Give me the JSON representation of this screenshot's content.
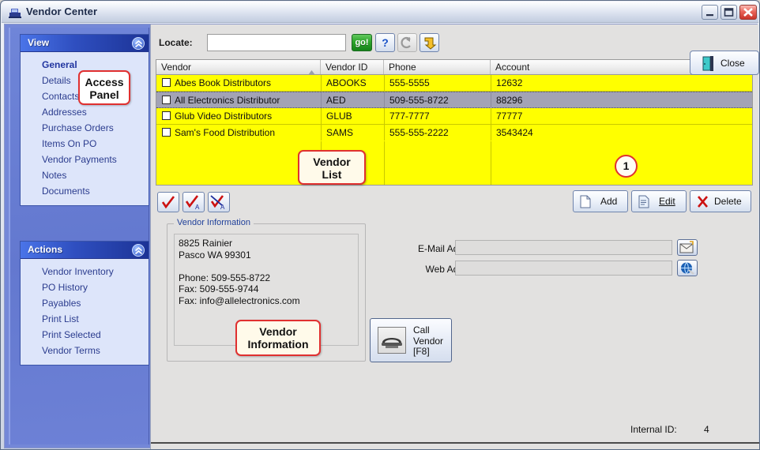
{
  "window": {
    "title": "Vendor Center",
    "icon": "cash-register-icon",
    "minimize_label": "Minimize",
    "maximize_label": "Maximize",
    "close_label": "Close"
  },
  "close_action": {
    "label": "Close",
    "icon": "door-exit-icon"
  },
  "access_panel": {
    "groups": [
      {
        "title": "View",
        "collapse_icon": "chevron-double-up-icon",
        "items": [
          {
            "label": "General",
            "active": true
          },
          {
            "label": "Details",
            "active": false
          },
          {
            "label": "Contacts",
            "active": false
          },
          {
            "label": "Addresses",
            "active": false
          },
          {
            "label": "Purchase Orders",
            "active": false
          },
          {
            "label": "Items On PO",
            "active": false
          },
          {
            "label": "Vendor Payments",
            "active": false
          },
          {
            "label": "Notes",
            "active": false
          },
          {
            "label": "Documents",
            "active": false
          }
        ]
      },
      {
        "title": "Actions",
        "collapse_icon": "chevron-double-up-icon",
        "items": [
          {
            "label": "Vendor Inventory",
            "active": false
          },
          {
            "label": "PO History",
            "active": false
          },
          {
            "label": "Payables",
            "active": false
          },
          {
            "label": "Print List",
            "active": false
          },
          {
            "label": "Print Selected",
            "active": false
          },
          {
            "label": "Vendor Terms",
            "active": false
          }
        ]
      }
    ]
  },
  "locate_bar": {
    "label": "Locate:",
    "input_value": "",
    "input_placeholder": "",
    "go_label": "go!",
    "help_label": "?",
    "refresh_icon": "refresh-arrow-icon",
    "jump_icon": "yellow-jump-arrow-icon"
  },
  "grid": {
    "columns": [
      {
        "label": "Vendor",
        "sorted": true,
        "sort_dir": "asc"
      },
      {
        "label": "Vendor ID",
        "sorted": false
      },
      {
        "label": "Phone",
        "sorted": false
      },
      {
        "label": "Account",
        "sorted": false
      }
    ],
    "rows": [
      {
        "checked": false,
        "selected": false,
        "vendor": "Abes Book Distributors",
        "vendor_id": "ABOOKS",
        "phone": "555-5555",
        "account": "12632"
      },
      {
        "checked": false,
        "selected": true,
        "vendor": "All Electronics Distributor",
        "vendor_id": "AED",
        "phone": "509-555-8722",
        "account": "88296"
      },
      {
        "checked": false,
        "selected": false,
        "vendor": "Glub Video Distributors",
        "vendor_id": "GLUB",
        "phone": "777-7777",
        "account": "77777"
      },
      {
        "checked": false,
        "selected": false,
        "vendor": "Sam's Food Distribution",
        "vendor_id": "SAMS",
        "phone": "555-555-2222",
        "account": "3543424"
      }
    ]
  },
  "grid_buttons": {
    "select_icon": "red-check-icon",
    "select_all_icon": "red-check-all-icon",
    "deselect_all_icon": "red-check-crossed-all-icon",
    "add_label": "Add",
    "edit_label": "Edit",
    "delete_label": "Delete",
    "add_icon": "new-page-icon",
    "edit_icon": "edit-page-icon",
    "delete_icon": "red-x-icon"
  },
  "vendor_information": {
    "legend": "Vendor Information",
    "text": "8825 Rainier\nPasco WA 99301\n\nPhone: 509-555-8722\nFax: 509-555-9744\nFax: info@allelectronics.com"
  },
  "contact_fields": {
    "email_label": "E-Mail Address:",
    "email_value": "",
    "email_button_icon": "send-mail-icon",
    "web_label": "Web Address:",
    "web_value": "",
    "web_button_icon": "globe-icon"
  },
  "call_vendor": {
    "label": "Call\nVendor\n[F8]",
    "icon": "telephone-icon"
  },
  "status": {
    "internal_id_label": "Internal ID:",
    "internal_id_value": "4"
  },
  "annotations": {
    "access_panel": "Access\nPanel",
    "vendor_list": "Vendor\nList",
    "vendor_information": "Vendor\nInformation",
    "badge_1": "1"
  },
  "colors": {
    "accent_blue": "#2f4fc0",
    "panel_blue": "#6378cf",
    "grid_highlight": "#ffff00",
    "row_selected": "#a3a3b4",
    "annotation_red": "#e03030",
    "go_green": "#2da52c",
    "content_grey": "#e2e1e0"
  }
}
